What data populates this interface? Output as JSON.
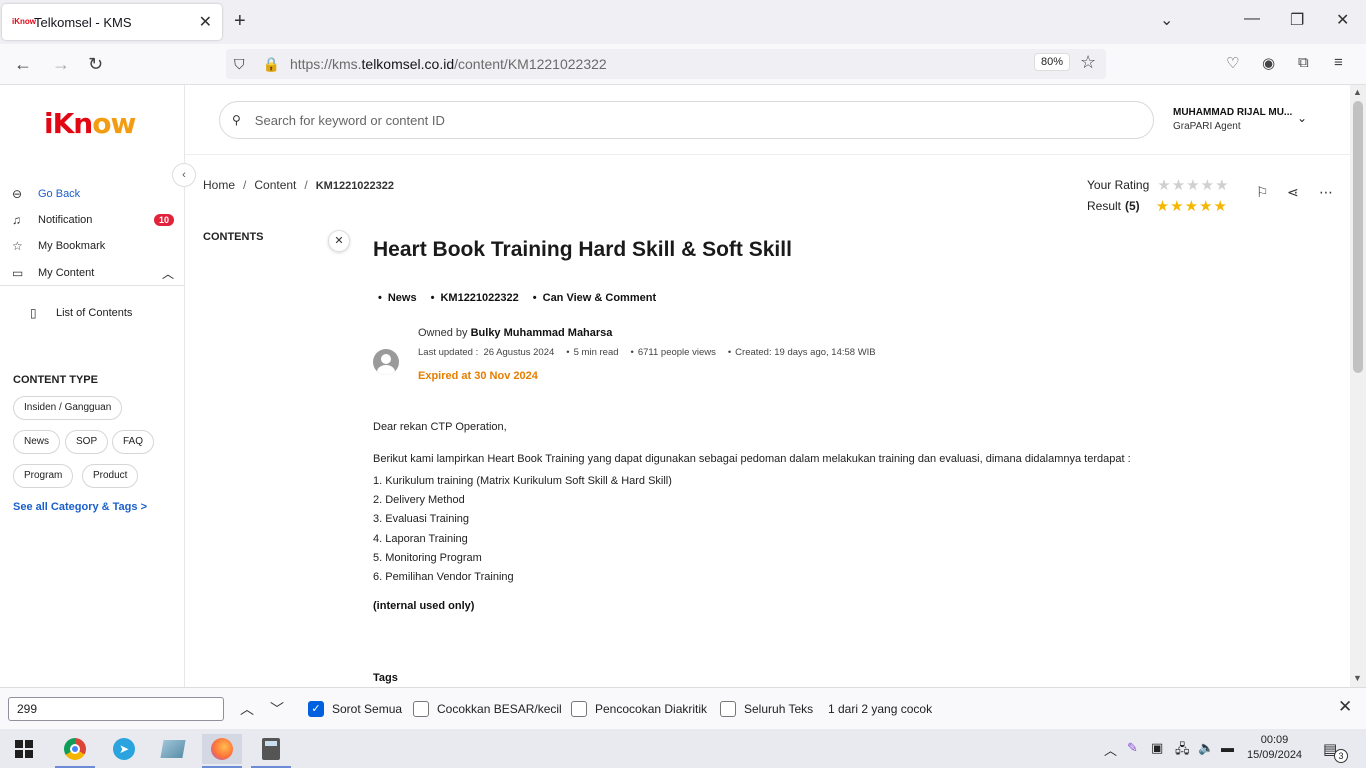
{
  "browser": {
    "tab_title": "Telkomsel - KMS",
    "favicon_text": "iKnow",
    "url_prefix": "https://kms.",
    "url_domain": "telkomsel.co.id",
    "url_path": "/content/KM1221022322",
    "zoom": "80%"
  },
  "sidebar": {
    "logo_a": "iKn",
    "logo_b": "ow",
    "items": [
      {
        "label": "Go Back",
        "icon": "back-icon"
      },
      {
        "label": "Notification",
        "icon": "bell-icon",
        "badge": "10"
      },
      {
        "label": "My Bookmark",
        "icon": "star-icon"
      },
      {
        "label": "My Content",
        "icon": "book-icon"
      },
      {
        "label": "List of Contents",
        "icon": "book-icon"
      }
    ],
    "content_type_title": "CONTENT TYPE",
    "chips": [
      "Insiden / Gangguan",
      "News",
      "SOP",
      "FAQ",
      "Program",
      "Product"
    ],
    "see_all": "See all Category & Tags >"
  },
  "header": {
    "search_placeholder": "Search for keyword or content ID",
    "user_name": "MUHAMMAD RIJAL MU...",
    "user_role": "GraPARI Agent"
  },
  "breadcrumb": [
    "Home",
    "Content",
    "KM1221022322"
  ],
  "rating": {
    "your_rating_label": "Your Rating",
    "result_label": "Result",
    "result_value": "(5)",
    "your_rating_stars": 0,
    "result_stars": 5
  },
  "contents_label": "CONTENTS",
  "article": {
    "title": "Heart Book Training Hard Skill & Soft Skill",
    "tags": [
      "News",
      "KM1221022322",
      "Can View & Comment"
    ],
    "owned_by_label": "Owned by",
    "owner": "Bulky Muhammad Maharsa",
    "last_updated_label": "Last updated :",
    "last_updated": "26 Agustus 2024",
    "read_time": "5 min read",
    "views": "6711 people views",
    "created": "Created: 19 days ago, 14:58 WIB",
    "expired": "Expired at 30 Nov 2024",
    "greeting": "Dear rekan CTP Operation,",
    "intro": "Berikut kami lampirkan Heart Book Training yang dapat digunakan sebagai pedoman dalam melakukan training dan evaluasi, dimana didalamnya terdapat :",
    "list": [
      " 1. Kurikulum training (Matrix Kurikulum Soft Skill & Hard Skill)",
      "2. Delivery Method",
      "3. Evaluasi Training",
      "4. Laporan Training",
      "5. Monitoring Program",
      "6. Pemilihan Vendor Training"
    ],
    "internal": "(internal used only)",
    "tags_title": "Tags"
  },
  "findbar": {
    "query": "299",
    "highlight_all": "Sorot Semua",
    "match_case": "Cocokkan BESAR/kecil",
    "diacritics": "Pencocokan Diakritik",
    "whole_words": "Seluruh Teks",
    "matches": "1 dari 2 yang cocok"
  },
  "taskbar": {
    "time": "00:09",
    "date": "15/09/2024",
    "notif_count": "3"
  }
}
